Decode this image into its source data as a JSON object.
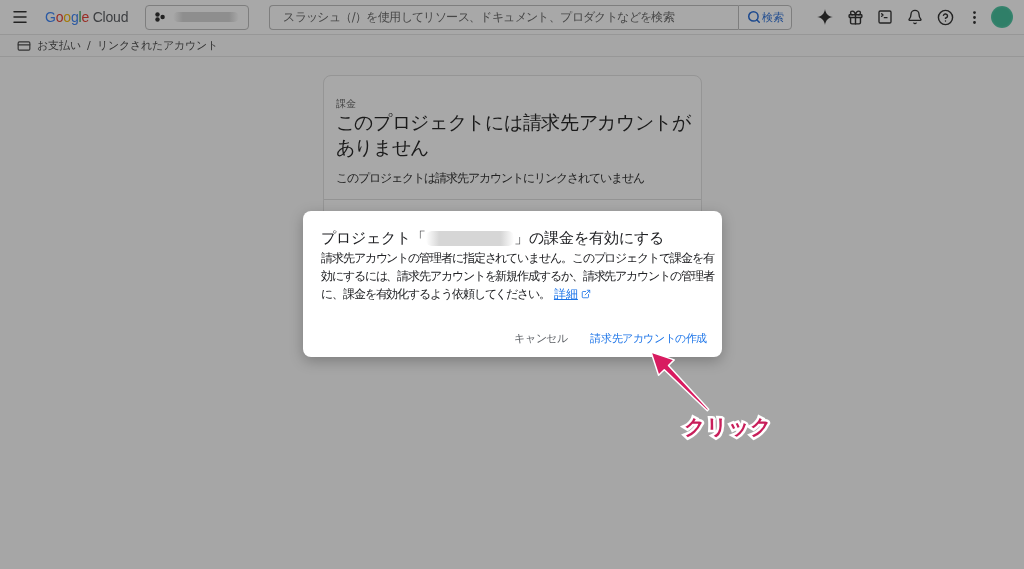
{
  "header": {
    "logo": "Google Cloud",
    "search": {
      "placeholder": "スラッシュ（/）を使用してリソース、ドキュメント、プロダクトなどを検索",
      "button": "検索"
    }
  },
  "breadcrumb": {
    "items": [
      "お支払い",
      "リンクされたアカウント"
    ],
    "separator": "/"
  },
  "card": {
    "eyebrow": "課金",
    "title": "このプロジェクトには請求先アカウントがありません",
    "subtitle": "このプロジェクトは請求先アカウントにリンクされていません"
  },
  "dialog": {
    "title_before": "プロジェクト「",
    "title_after": "」の課金を有効にする",
    "message": "請求先アカウントの管理者に指定されていません。このプロジェクトで課金を有効にするには、請求先アカウントを新規作成するか、請求先アカウントの管理者に、課金を有効化するよう依頼してください。",
    "link": "詳細",
    "buttons": [
      {
        "label": "キャンセル",
        "kind": "text"
      },
      {
        "label": "請求先アカウントの作成",
        "kind": "primary"
      }
    ]
  },
  "annotation": {
    "label": "クリック"
  }
}
